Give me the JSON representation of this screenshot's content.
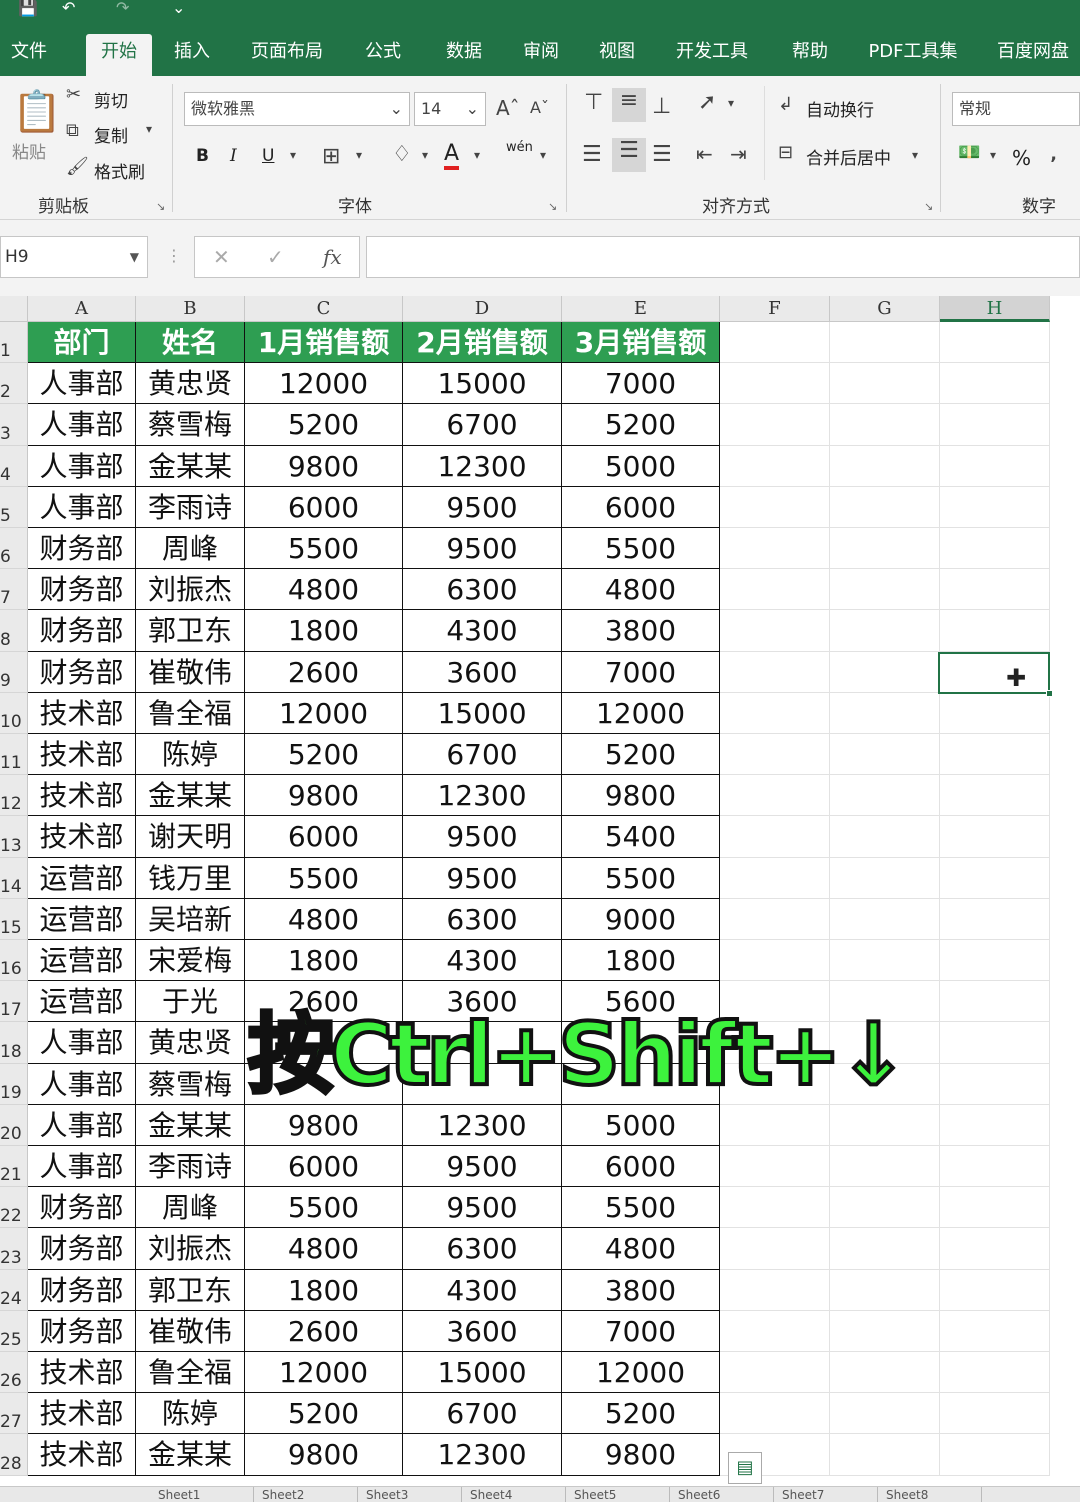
{
  "tabs": [
    "文件",
    "开始",
    "插入",
    "页面布局",
    "公式",
    "数据",
    "审阅",
    "视图",
    "开发工具",
    "帮助",
    "PDF工具集",
    "百度网盘"
  ],
  "active_tab": "开始",
  "ribbon": {
    "clipboard": {
      "paste": "粘贴",
      "cut": "剪切",
      "copy": "复制",
      "format_painter": "格式刷",
      "label": "剪贴板"
    },
    "font": {
      "name": "微软雅黑",
      "size": "14",
      "label": "字体",
      "bold": "B",
      "italic": "I",
      "underline": "U",
      "color": "A",
      "pinyin": "wén"
    },
    "alignment": {
      "wrap": "自动换行",
      "merge": "合并后居中",
      "label": "对齐方式"
    },
    "number": {
      "format": "常规",
      "percent": "%",
      "label": "数字"
    }
  },
  "formula_bar": {
    "name_box": "H9",
    "fx": "fx",
    "value": ""
  },
  "columns": [
    "A",
    "B",
    "C",
    "D",
    "E",
    "F",
    "G",
    "H"
  ],
  "header_row": [
    "部门",
    "姓名",
    "1月销售额",
    "2月销售额",
    "3月销售额"
  ],
  "rows": [
    [
      "人事部",
      "黄忠贤",
      "12000",
      "15000",
      "7000"
    ],
    [
      "人事部",
      "蔡雪梅",
      "5200",
      "6700",
      "5200"
    ],
    [
      "人事部",
      "金某某",
      "9800",
      "12300",
      "5000"
    ],
    [
      "人事部",
      "李雨诗",
      "6000",
      "9500",
      "6000"
    ],
    [
      "财务部",
      "周峰",
      "5500",
      "9500",
      "5500"
    ],
    [
      "财务部",
      "刘振杰",
      "4800",
      "6300",
      "4800"
    ],
    [
      "财务部",
      "郭卫东",
      "1800",
      "4300",
      "3800"
    ],
    [
      "财务部",
      "崔敬伟",
      "2600",
      "3600",
      "7000"
    ],
    [
      "技术部",
      "鲁全福",
      "12000",
      "15000",
      "12000"
    ],
    [
      "技术部",
      "陈婷",
      "5200",
      "6700",
      "5200"
    ],
    [
      "技术部",
      "金某某",
      "9800",
      "12300",
      "9800"
    ],
    [
      "技术部",
      "谢天明",
      "6000",
      "9500",
      "5400"
    ],
    [
      "运营部",
      "钱万里",
      "5500",
      "9500",
      "5500"
    ],
    [
      "运营部",
      "吴培新",
      "4800",
      "6300",
      "9000"
    ],
    [
      "运营部",
      "宋爱梅",
      "1800",
      "4300",
      "1800"
    ],
    [
      "运营部",
      "于光",
      "2600",
      "3600",
      "5600"
    ],
    [
      "人事部",
      "黄忠贤",
      "",
      "",
      ""
    ],
    [
      "人事部",
      "蔡雪梅",
      "",
      "",
      ""
    ],
    [
      "人事部",
      "金某某",
      "9800",
      "12300",
      "5000"
    ],
    [
      "人事部",
      "李雨诗",
      "6000",
      "9500",
      "6000"
    ],
    [
      "财务部",
      "周峰",
      "5500",
      "9500",
      "5500"
    ],
    [
      "财务部",
      "刘振杰",
      "4800",
      "6300",
      "4800"
    ],
    [
      "财务部",
      "郭卫东",
      "1800",
      "4300",
      "3800"
    ],
    [
      "财务部",
      "崔敬伟",
      "2600",
      "3600",
      "7000"
    ],
    [
      "技术部",
      "鲁全福",
      "12000",
      "15000",
      "12000"
    ],
    [
      "技术部",
      "陈婷",
      "5200",
      "6700",
      "5200"
    ],
    [
      "技术部",
      "金某某",
      "9800",
      "12300",
      "9800"
    ]
  ],
  "overlay_text": "按Ctrl+Shift+↓",
  "sheet_tabs": [
    "Sheet1",
    "Sheet2",
    "Sheet3",
    "Sheet4",
    "Sheet5",
    "Sheet6",
    "Sheet7",
    "Sheet8"
  ],
  "colors": {
    "excel_green": "#217346",
    "header_fill": "#2e9e52",
    "overlay": "#3df23d"
  }
}
